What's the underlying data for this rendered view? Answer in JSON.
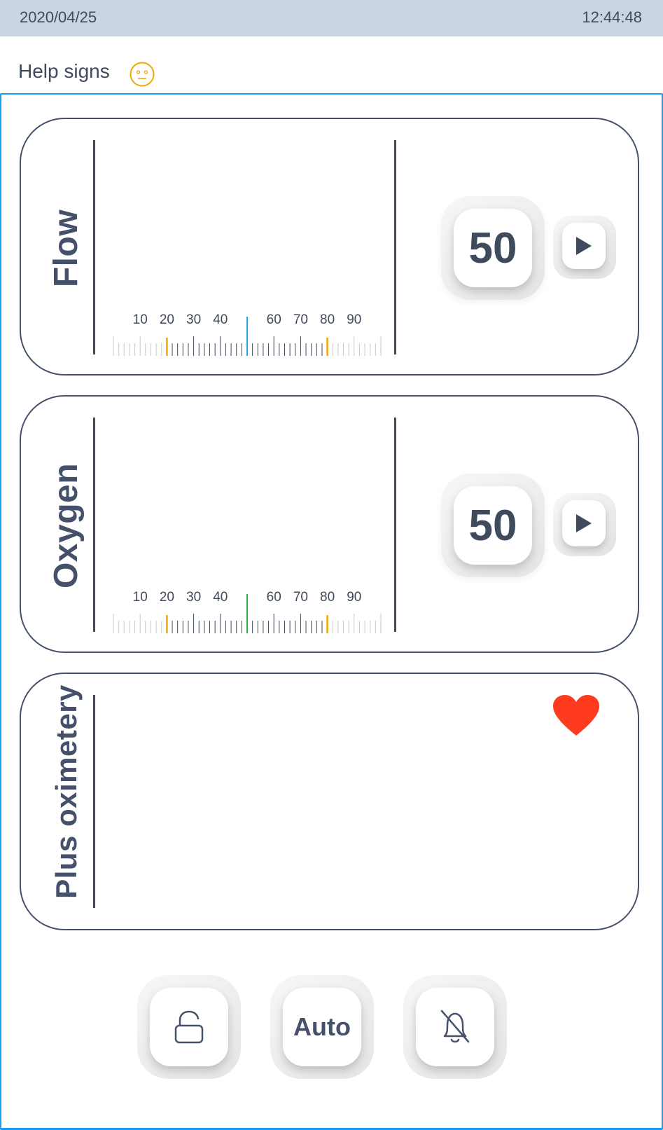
{
  "status_bar": {
    "date": "2020/04/25",
    "time": "12:44:48"
  },
  "header": {
    "title": "Help signs",
    "status_icon": "neutral-face-icon",
    "status_color": "#f0a800"
  },
  "panels": [
    {
      "label": "Flow",
      "value": "50",
      "scale_labels": [
        "10",
        "20",
        "30",
        "40",
        "60",
        "70",
        "80",
        "90"
      ],
      "indicator_color": "#29a9e0",
      "limit_color": "#f0a800",
      "action_icon": "play-icon"
    },
    {
      "label": "Oxygen",
      "value": "50",
      "scale_labels": [
        "10",
        "20",
        "30",
        "40",
        "60",
        "70",
        "80",
        "90"
      ],
      "indicator_color": "#2bb24c",
      "limit_color": "#f0a800",
      "action_icon": "play-icon"
    },
    {
      "label": "Plus oximetery",
      "icon": "heart-icon",
      "icon_color": "#ff3b1f"
    }
  ],
  "bottom_controls": {
    "lock_icon": "unlock-icon",
    "auto_label": "Auto",
    "mute_icon": "bell-off-icon"
  },
  "colors": {
    "frame": "#1e9cf0",
    "text": "#3f4a5c",
    "status_bg": "#cbd5e1"
  }
}
